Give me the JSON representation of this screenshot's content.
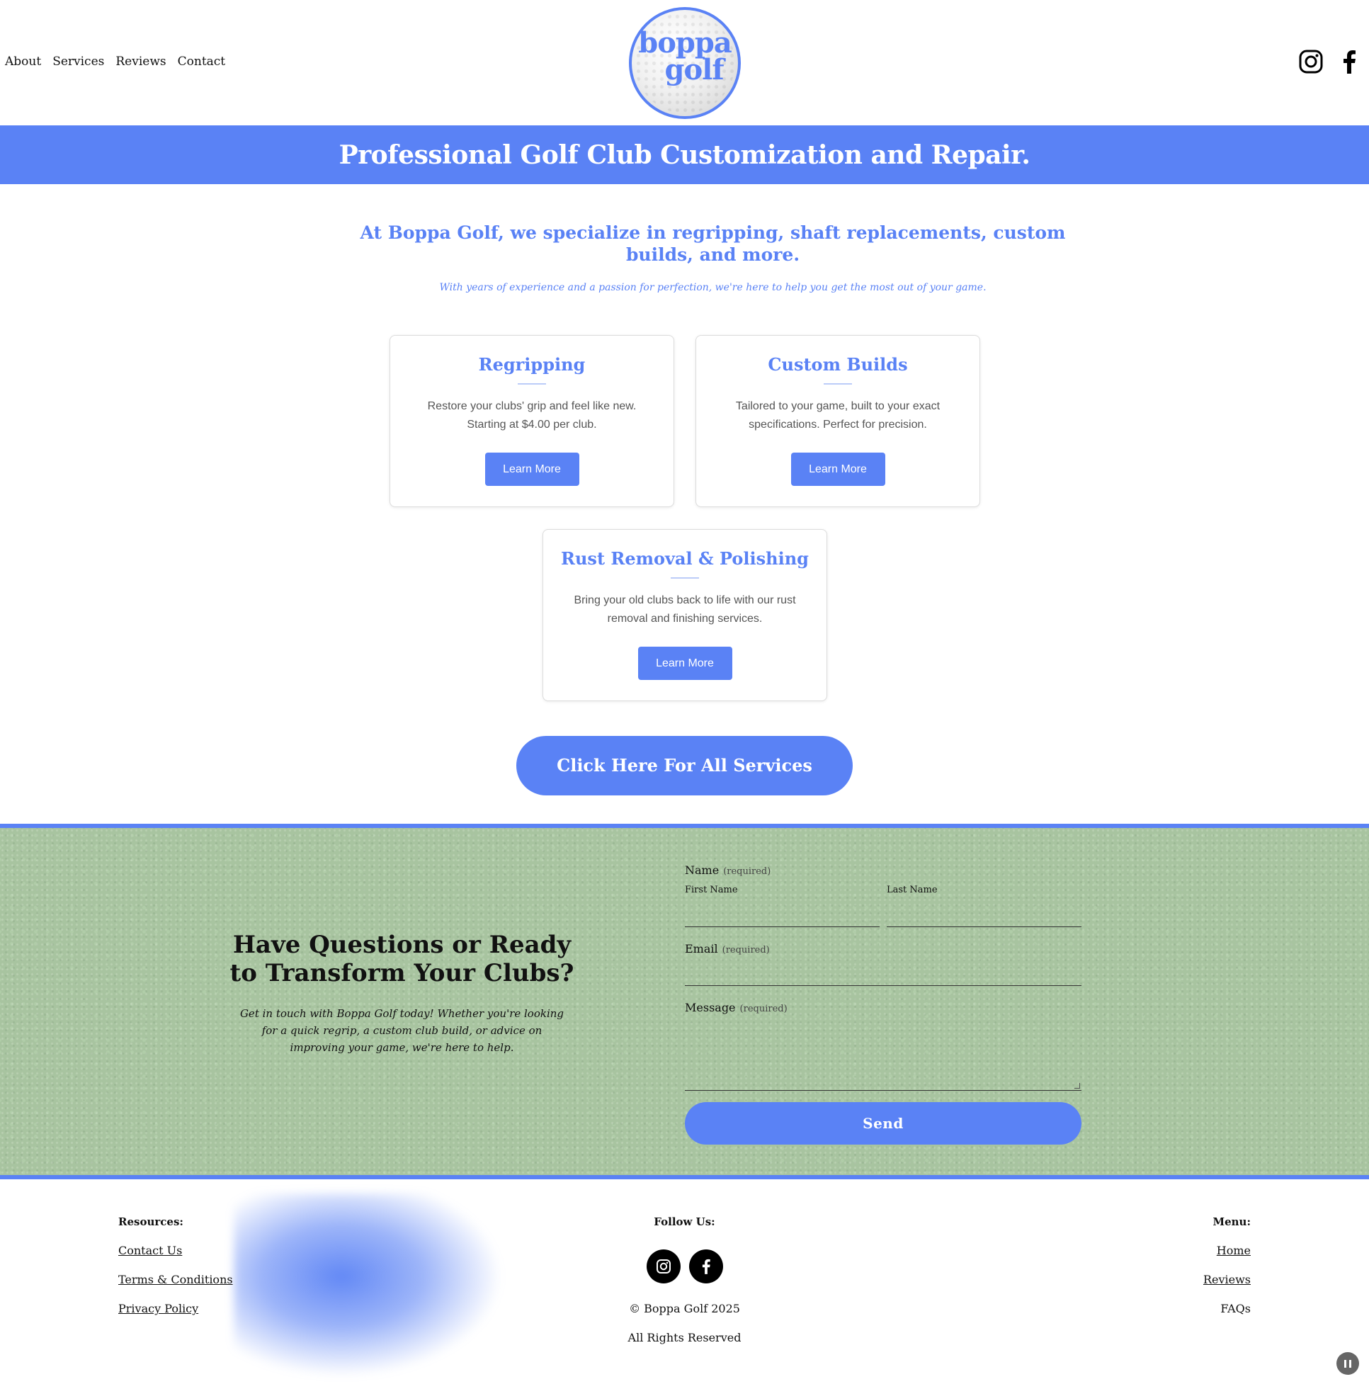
{
  "nav": {
    "items": [
      {
        "label": "About"
      },
      {
        "label": "Services"
      },
      {
        "label": "Reviews"
      },
      {
        "label": "Contact"
      }
    ]
  },
  "logo": {
    "line1": "boppa",
    "line2": "golf"
  },
  "social": {
    "instagram_icon": "instagram-icon",
    "facebook_icon": "facebook-icon"
  },
  "banner": {
    "title": "Professional Golf Club Customization and Repair."
  },
  "intro": {
    "headline": "At Boppa Golf, we specialize in regripping, shaft replacements, custom builds, and more.",
    "subtext": "With years of experience and a passion for perfection, we're here to help you get the most out of your game."
  },
  "services": [
    {
      "title": "Regripping",
      "description": "Restore your clubs' grip and feel like new. Starting at $4.00 per club.",
      "button": "Learn More"
    },
    {
      "title": "Custom Builds",
      "description": "Tailored to your game, built to your exact specifications. Perfect for precision.",
      "button": "Learn More"
    },
    {
      "title": "Rust Removal & Polishing",
      "description": "Bring your old clubs back to life with our rust removal and finishing services.",
      "button": "Learn More"
    }
  ],
  "all_services_button": "Click Here For All Services",
  "contact": {
    "title": "Have Questions or Ready to Transform Your Clubs?",
    "text": "Get in touch with Boppa Golf today! Whether you're looking for a quick regrip, a custom club build, or advice on improving your game, we're here to help.",
    "name_label": "Name",
    "email_label": "Email",
    "message_label": "Message",
    "required": "(required)",
    "first_name_label": "First Name",
    "last_name_label": "Last Name",
    "first_name_value": "",
    "last_name_value": "",
    "email_value": "",
    "message_value": "",
    "send_button": "Send"
  },
  "footer": {
    "resources_heading": "Resources:",
    "resources": [
      "Contact Us",
      "Terms & Conditions",
      "Privacy Policy"
    ],
    "follow_heading": "Follow Us:",
    "copyright": "© Boppa Golf 2025",
    "rights": "All Rights Reserved",
    "menu_heading": "Menu:",
    "menu": [
      "Home",
      "Reviews",
      "FAQs"
    ]
  },
  "colors": {
    "accent": "#5a82f5",
    "contact_bg": "#a8c4a0"
  }
}
